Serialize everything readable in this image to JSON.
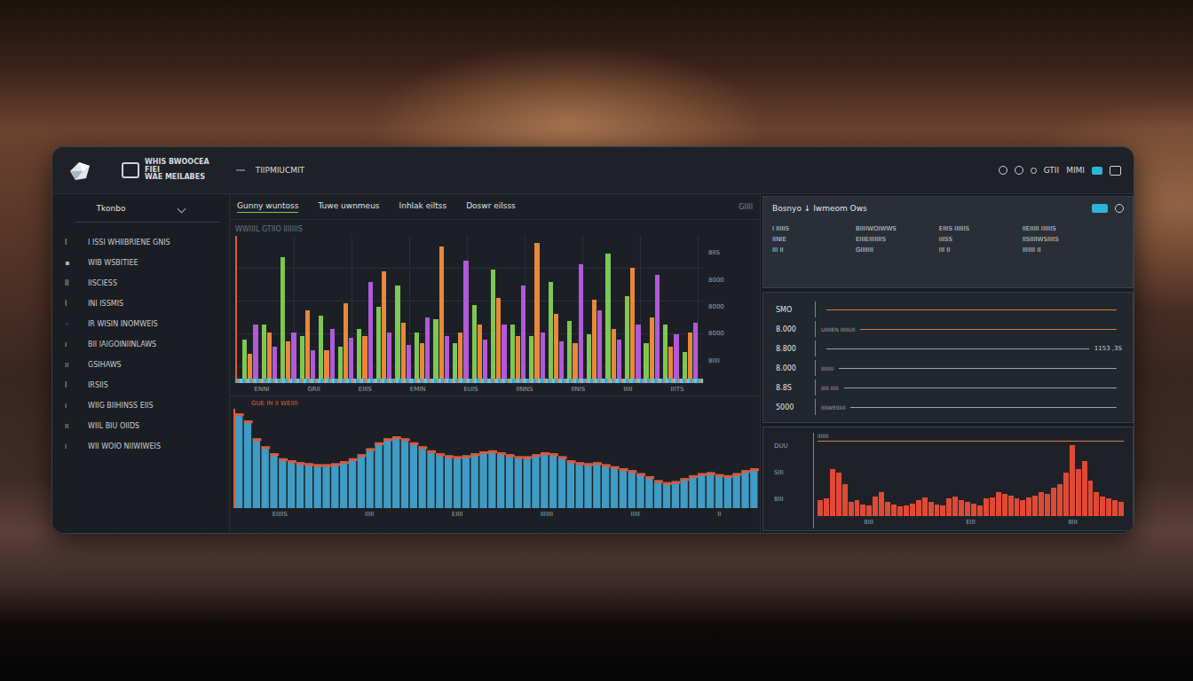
{
  "brand": {
    "lines": [
      "WHIS BWOOCEA",
      "FIEI",
      "WAE MEILABES"
    ],
    "title": "TIIPMIUCMIT"
  },
  "header_right": {
    "texts": [
      "GTII",
      "MIMI"
    ]
  },
  "sidebar": {
    "title": "Tkonbo",
    "items": [
      {
        "mark": "I",
        "label": "I ISSI WHIIBRIENE GNIS"
      },
      {
        "mark": "▪",
        "label": "WIB WSBITIEE"
      },
      {
        "mark": "II",
        "label": "IISCIESS"
      },
      {
        "mark": "I",
        "label": "INI ISSMIS"
      },
      {
        "mark": "◦",
        "label": "IR WISIN INOMWEIS"
      },
      {
        "mark": "ı",
        "label": "BII IAIGOINIINLAWS"
      },
      {
        "mark": "ıı",
        "label": "GSIHAWS"
      },
      {
        "mark": "I",
        "label": "IRSIIS"
      },
      {
        "mark": "ı",
        "label": "WIIG BIIHINSS EIIS"
      },
      {
        "mark": "ıı",
        "label": "WIIL BIU OIIDS"
      },
      {
        "mark": "ı",
        "label": "WII WOIO NIIWIWEIS"
      }
    ]
  },
  "tabs": [
    {
      "label": "Gunny wuntoss",
      "selected": true
    },
    {
      "label": "Tuwe uwnmeus",
      "selected": false
    },
    {
      "label": "Inhlak eiltss",
      "selected": false
    },
    {
      "label": "Doswr eilsss",
      "selected": false
    }
  ],
  "tab_extra": "GIIII",
  "candle_chart": {
    "title": "WWIIIL GTIIO IIIIIIIS",
    "y_ticks": [
      "8IIS",
      "8000",
      "8000",
      "8000",
      "8IIII"
    ],
    "x_ticks": [
      "ENNI",
      "GRII",
      "EIIIS",
      "EMIN",
      "EUIS",
      "IINNS",
      "IINIS",
      "IIIII",
      "IIITS"
    ],
    "series": [
      {
        "color": "#7ec850",
        "values": [
          2200,
          3000,
          6800,
          2400,
          3500,
          1800,
          2800,
          4000,
          5200,
          2600,
          3300,
          2000,
          4100,
          6100,
          3000,
          2400,
          5400,
          3200,
          2500,
          7000,
          4600,
          2000,
          3000,
          1500
        ]
      },
      {
        "color": "#e8883a",
        "values": [
          1400,
          2600,
          2100,
          3800,
          1600,
          4200,
          2400,
          6000,
          3100,
          2000,
          7400,
          2600,
          3000,
          4500,
          2400,
          7600,
          3600,
          2000,
          4400,
          2800,
          6200,
          3400,
          1800,
          2600
        ]
      },
      {
        "color": "#b05ad8",
        "values": [
          3000,
          1800,
          2600,
          1600,
          2800,
          2300,
          5400,
          2600,
          1900,
          3400,
          2400,
          6600,
          2200,
          3000,
          5200,
          2600,
          2100,
          6400,
          3800,
          2200,
          3000,
          5800,
          2500,
          3100
        ]
      }
    ]
  },
  "area_chart": {
    "title": "GUE IN II WEIIII",
    "x_ticks": [
      "EIIIIS",
      "IIIII",
      "EIIII",
      "IIIIIII",
      "IIIII",
      "II"
    ],
    "values": [
      95,
      88,
      70,
      62,
      55,
      50,
      48,
      46,
      45,
      44,
      44,
      45,
      47,
      50,
      54,
      60,
      66,
      70,
      72,
      70,
      66,
      62,
      58,
      55,
      53,
      52,
      53,
      55,
      57,
      58,
      56,
      54,
      52,
      52,
      54,
      56,
      55,
      52,
      48,
      46,
      45,
      46,
      44,
      42,
      40,
      38,
      35,
      32,
      28,
      26,
      27,
      30,
      33,
      35,
      36,
      34,
      33,
      35,
      38,
      40
    ]
  },
  "table_panel": {
    "title": "Bosnyo ↓ Iwmeom Ows",
    "toggle_on": true,
    "rows": [
      [
        "I IIIIIS",
        "BIIIIWOIWWS",
        "EIIIS IIIIIIS",
        "IIEIIIII IIIIIIS"
      ],
      [
        "IINIE",
        "EIIIEIIIIIIIS",
        "IIISS",
        "IISIIIIWSIIIIS"
      ],
      [
        "III II",
        "GIIIIIII",
        "III II",
        "IIIIIII II"
      ]
    ]
  },
  "level_panel": {
    "rows": [
      {
        "label": "SMO",
        "note": "",
        "value": "",
        "color": "#d9784a"
      },
      {
        "label": "8.000",
        "note": "UIIIIEN IIIIIUII",
        "value": "",
        "color": "#d9784a"
      },
      {
        "label": "8.800",
        "note": "",
        "value": "1153  ,3S",
        "color": "#9aa0a8"
      },
      {
        "label": "8.000",
        "note": "IIIIIIII",
        "value": "",
        "color": "#9aa0a8"
      },
      {
        "label": "8.8S",
        "note": "IIIII IIIII",
        "value": "",
        "color": "#9aa0a8"
      },
      {
        "label": "5000",
        "note": "IIIIWEIIIIII",
        "value": "",
        "color": "#9aa0a8"
      }
    ]
  },
  "red_chart": {
    "title": "IIIIIII",
    "y_ticks": [
      "DUU",
      "SIII",
      "8III"
    ],
    "x_ticks": [
      "8III",
      "EIII",
      "8III"
    ],
    "values": [
      20,
      22,
      60,
      55,
      40,
      18,
      20,
      15,
      14,
      25,
      30,
      18,
      15,
      12,
      14,
      16,
      20,
      24,
      18,
      15,
      14,
      22,
      25,
      20,
      18,
      16,
      14,
      22,
      24,
      30,
      28,
      26,
      22,
      20,
      24,
      26,
      30,
      28,
      36,
      40,
      55,
      90,
      60,
      70,
      45,
      30,
      25,
      22,
      20,
      18
    ]
  }
}
